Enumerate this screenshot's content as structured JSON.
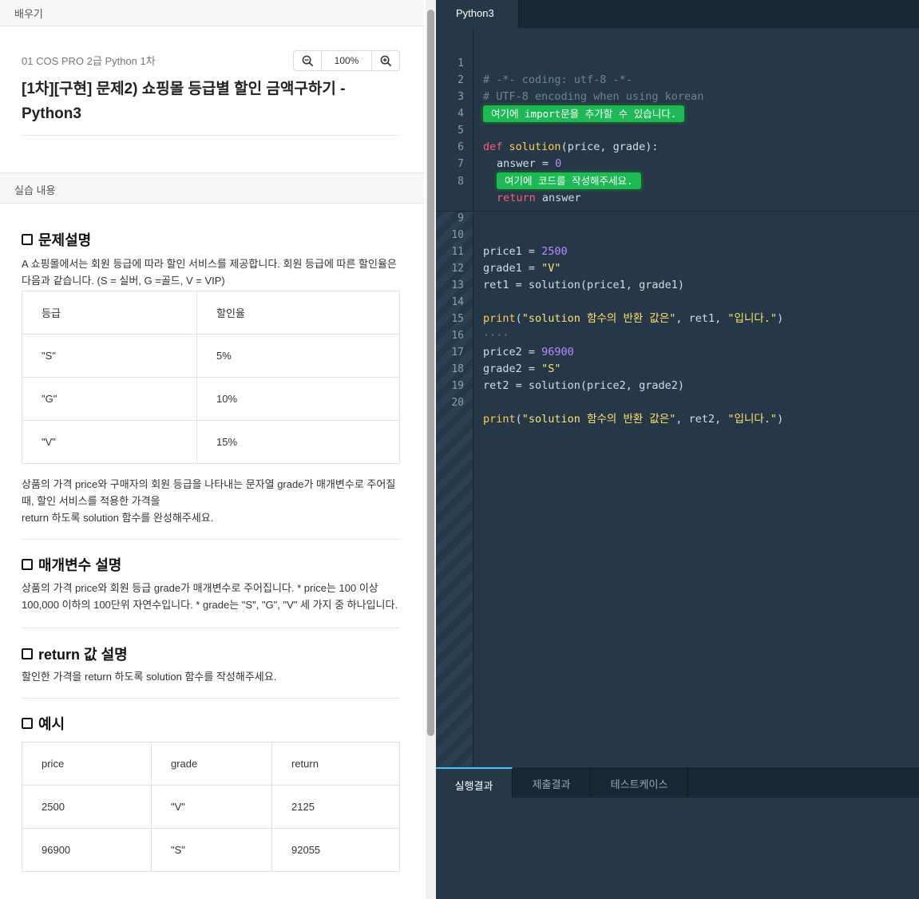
{
  "left": {
    "learn_label": "배우기",
    "course": "01 COS PRO 2급 Python 1차",
    "zoom": "100%",
    "title": "[1차][구현] 문제2) 쇼핑몰 등급별 할인 금액구하기 - Python3",
    "content_label": "실습 내용",
    "sections": {
      "problem": {
        "title": "문제설명",
        "desc": "A 쇼핑몰에서는 회원 등급에 따라 할인 서비스를 제공합니다. 회원 등급에 따른 할인율은 다음과 같습니다. (S = 실버, G =골드, V = VIP)",
        "table_header": [
          "등급",
          "할인율"
        ],
        "table_rows": [
          [
            "\"S\"",
            "5%"
          ],
          [
            "\"G\"",
            "10%"
          ],
          [
            "\"V\"",
            "15%"
          ]
        ],
        "desc2": "상품의 가격 price와 구매자의 회원 등급을 나타내는 문자열 grade가 매개변수로 주어질 때, 할인 서비스를 적용한 가격을",
        "desc3": "return 하도록 solution 함수를 완성해주세요."
      },
      "params": {
        "title": "매개변수 설명",
        "desc": "상품의 가격 price와 회원 등급 grade가 매개변수로 주어집니다. * price는 100 이상 100,000 이하의 100단위 자연수입니다. * grade는 \"S\", \"G\", \"V\" 세 가지 중 하나입니다."
      },
      "return": {
        "title": "return 값 설명",
        "desc": "할인한 가격을 return 하도록 solution 함수를 작성해주세요."
      },
      "example": {
        "title": "예시",
        "table_header": [
          "price",
          "grade",
          "return"
        ],
        "table_rows": [
          [
            "2500",
            "\"V\"",
            "2125"
          ],
          [
            "96900",
            "\"S\"",
            "92055"
          ]
        ]
      }
    }
  },
  "editor": {
    "tab": "Python3",
    "line_numbers": [
      "1",
      "2",
      "3",
      "4",
      "5",
      "6",
      "7",
      "8",
      "9",
      "10",
      "11",
      "12",
      "13",
      "14",
      "15",
      "16",
      "17",
      "18",
      "19",
      "20"
    ],
    "code": {
      "l1": "# -*- coding: utf-8 -*-",
      "l2": "# UTF-8 encoding when using korean",
      "l3_hint": "여기에 import문을 추가할 수 있습니다.",
      "l5_kw": "def",
      "l5_fn": "solution",
      "l5_rest": "(price, grade):",
      "l6_a": "answer = ",
      "l6_num": "0",
      "l7_hint": "여기에 코드를 작성해주세요.",
      "l8_kw": "return",
      "l8_rest": " answer",
      "l10_a": "price1 = ",
      "l10_num": "2500",
      "l11_a": "grade1 = ",
      "l11_str": "\"V\"",
      "l12": "ret1 = solution(price1, grade1)",
      "l14_fn": "print",
      "l14_p1": "(",
      "l14_s1": "\"solution 함수의 반환 값은\"",
      "l14_mid": ", ret1, ",
      "l14_s2": "\"입니다.\"",
      "l14_p2": ")",
      "l15": "····",
      "l16_a": "price2 = ",
      "l16_num": "96900",
      "l17_a": "grade2 = ",
      "l17_str": "\"S\"",
      "l18": "ret2 = solution(price2, grade2)",
      "l20_fn": "print",
      "l20_p1": "(",
      "l20_s1": "\"solution 함수의 반환 값은\"",
      "l20_mid": ", ret2, ",
      "l20_s2": "\"입니다.\"",
      "l20_p2": ")"
    }
  },
  "bottom_tabs": [
    "실행결과",
    "제출결과",
    "테스트케이스"
  ],
  "colors": {
    "editor_bg": "#263747",
    "keyword": "#ff5b7d",
    "function": "#ffcc55",
    "number": "#b68bff",
    "string": "#ffe36e",
    "hint_green": "#1db954",
    "active_tab_accent": "#44c2ff"
  }
}
